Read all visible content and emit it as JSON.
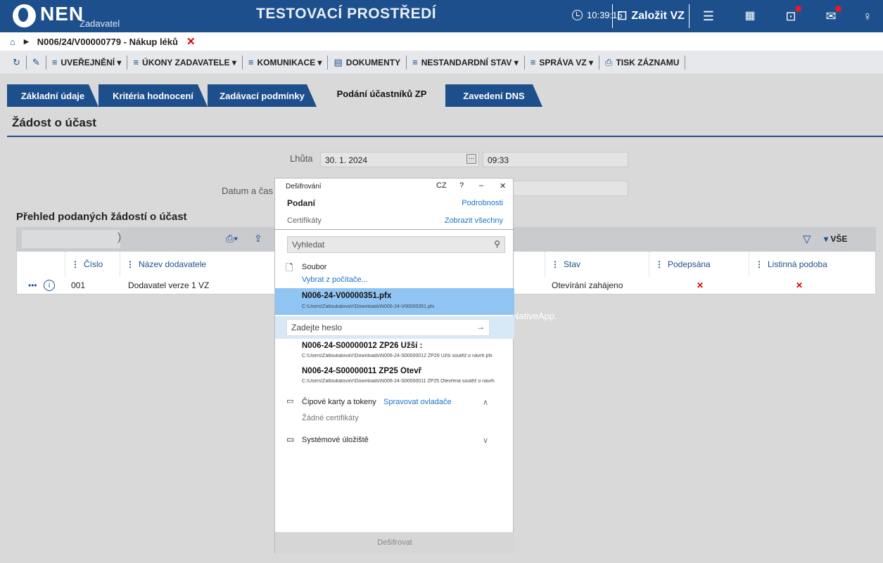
{
  "app": {
    "brand": "NEN",
    "brand_sub": "Zadavatel",
    "environment": "TESTOVACÍ PROSTŘEDÍ",
    "time": "10:39:15",
    "create_label": "Založit VZ"
  },
  "breadcrumb": {
    "title": "N006/24/V00000779 - Nákup léků",
    "close": "✕"
  },
  "toolbar": {
    "items": [
      "UVEŘEJNĚNÍ ▾",
      "ÚKONY ZADAVATELE ▾",
      "KOMUNIKACE ▾",
      "DOKUMENTY",
      "NESTANDARDNÍ STAV ▾",
      "SPRÁVA VZ ▾",
      "TISK ZÁZNAMU"
    ]
  },
  "tabs": [
    "Základní údaje",
    "Kritéria hodnocení",
    "Zadávací podmínky",
    "Podání účastníků ZP",
    "Zavedení DNS"
  ],
  "section": {
    "title": "Žádost o účast"
  },
  "form": {
    "deadline_label": "Lhůta",
    "deadline_date": "30. 1. 2024",
    "deadline_time": "09:33",
    "datetime_label": "Datum a čas"
  },
  "list": {
    "title": "Přehled podaných žádostí o účast",
    "filter_all": "VŠE",
    "columns": [
      "Číslo",
      "Název dodavatele",
      "Stav",
      "Podepsána",
      "Listinná podoba"
    ],
    "rows": [
      {
        "more": "•••",
        "info": "i",
        "number": "001",
        "supplier": "Dodavatel verze 1 VZ",
        "status": "Otevírání zahájeno",
        "signed": "✕",
        "paper": "✕"
      }
    ]
  },
  "background_note": "NativeApp.",
  "dialog": {
    "title": "Dešifrování",
    "lang": "CZ",
    "help": "?",
    "minimize": "–",
    "close": "✕",
    "subtitle": "Podaní",
    "details_link": "Podrobnosti",
    "cert_label": "Certifikáty",
    "show_all_link": "Zobrazit všechny",
    "search_placeholder": "Vyhledat",
    "file_section": "Soubor",
    "pick_file_link": "Vybrat z počítače...",
    "files": [
      {
        "name": "N006-24-V00000351.pfx",
        "path": "C:\\Users\\ZatloukalovaV\\Downloads\\N006-24-V00000351.pfx"
      },
      {
        "name": "N006-24-S00000012 ZP26 Užší :",
        "path": "C:\\Users\\ZatloukalovaV\\Downloads\\N006-24-S00000012 ZP26 Užší soutěž o návrh.pfx"
      },
      {
        "name": "N006-24-S00000011 ZP25 Otevř",
        "path": "C:\\Users\\ZatloukalovaV\\Downloads\\N006-24-S00000011 ZP25 Otevřená soutěž o návrh"
      }
    ],
    "password_placeholder": "Zadejte heslo",
    "smartcards_label": "Čipové karty a tokeny",
    "manage_drivers_link": "Spravovat ovladače",
    "no_certs": "Žádné certifikáty",
    "system_store_label": "Systémové úložiště",
    "decrypt_button": "Dešifrovat"
  }
}
